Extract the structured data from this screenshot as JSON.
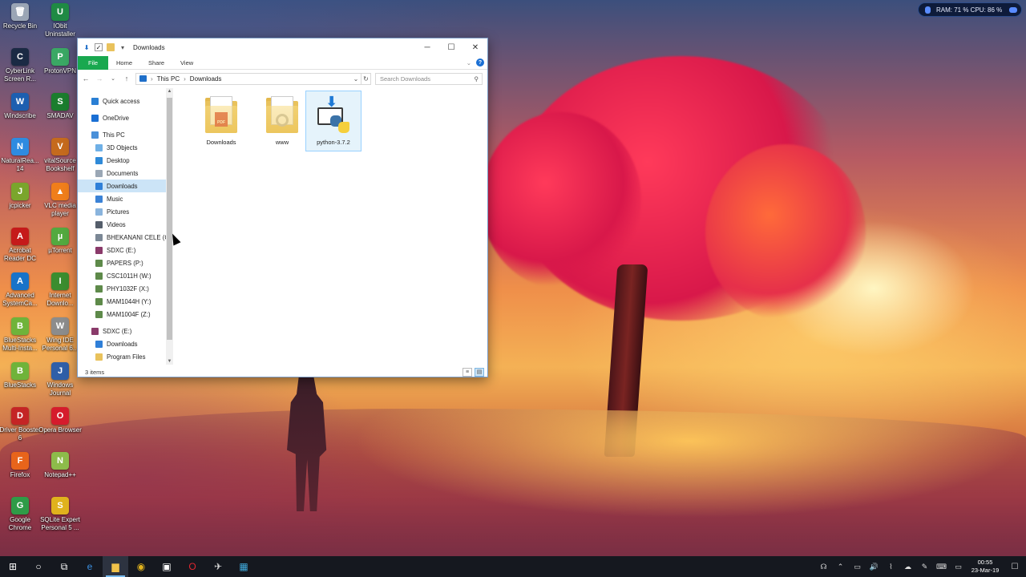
{
  "desktop": {
    "icons": [
      {
        "label": "Recycle Bin",
        "color": "#9aa5b5",
        "glyph": "🗑"
      },
      {
        "label": "IObit Uninstaller",
        "color": "#1f8a44",
        "glyph": "U"
      },
      {
        "label": "CyberLink Screen R...",
        "color": "#1b2a44",
        "glyph": "C"
      },
      {
        "label": "ProtonVPN",
        "color": "#3aa864",
        "glyph": "P"
      },
      {
        "label": "Windscribe",
        "color": "#1d5fb0",
        "glyph": "W"
      },
      {
        "label": "SMADAV",
        "color": "#1b7d2e",
        "glyph": "S"
      },
      {
        "label": "NaturalRea... 14",
        "color": "#2f8be0",
        "glyph": "N"
      },
      {
        "label": "vitalSource Bookshelf",
        "color": "#c56a1d",
        "glyph": "V"
      },
      {
        "label": "jcpicker",
        "color": "#7aa52c",
        "glyph": "J"
      },
      {
        "label": "VLC media player",
        "color": "#f07e1b",
        "glyph": "▲"
      },
      {
        "label": "Acrobat Reader DC",
        "color": "#c51a1a",
        "glyph": "A"
      },
      {
        "label": "µTorrent",
        "color": "#53a93f",
        "glyph": "µ"
      },
      {
        "label": "Advanced SystemCa...",
        "color": "#1873c9",
        "glyph": "A"
      },
      {
        "label": "Internet Downlo...",
        "color": "#3b8d2f",
        "glyph": "I"
      },
      {
        "label": "BlueStacks Multi-Insta...",
        "color": "#6fb33a",
        "glyph": "B"
      },
      {
        "label": "Wing IDE Personal 6...",
        "color": "#8c8c8c",
        "glyph": "W"
      },
      {
        "label": "BlueStacks",
        "color": "#6fb33a",
        "glyph": "B"
      },
      {
        "label": "Windows Journal",
        "color": "#2f5fa8",
        "glyph": "J"
      },
      {
        "label": "Driver Booster 6",
        "color": "#c42525",
        "glyph": "D"
      },
      {
        "label": "Opera Browser",
        "color": "#d51c2c",
        "glyph": "O"
      },
      {
        "label": "Firefox",
        "color": "#e8641b",
        "glyph": "F"
      },
      {
        "label": "Notepad++",
        "color": "#8dbb4a",
        "glyph": "N"
      },
      {
        "label": "Google Chrome",
        "color": "#2f9b47",
        "glyph": "G"
      },
      {
        "label": "SQLite Expert Personal 5 ...",
        "color": "#e0b21d",
        "glyph": "S"
      }
    ]
  },
  "widget": {
    "text": "RAM: 71 %  CPU: 86 %"
  },
  "window": {
    "title": "Downloads",
    "controls": {
      "minimize": "─",
      "maximize": "☐",
      "close": "✕"
    },
    "ribbon": {
      "file": "File",
      "tabs": [
        "Home",
        "Share",
        "View"
      ],
      "help": "?"
    },
    "address": {
      "root": "This PC",
      "current": "Downloads",
      "separator": "›"
    },
    "search_placeholder": "Search Downloads",
    "nav": [
      {
        "label": "Quick access",
        "icon": "star-icon",
        "color": "#2a7fd4",
        "indent": 1
      },
      {
        "label": "OneDrive",
        "icon": "cloud-icon",
        "color": "#1a6fd4",
        "indent": 1
      },
      {
        "label": "This PC",
        "icon": "computer-icon",
        "color": "#4a90d9",
        "indent": 1
      },
      {
        "label": "3D Objects",
        "icon": "cube-icon",
        "color": "#6fb0e6",
        "indent": 2
      },
      {
        "label": "Desktop",
        "icon": "desktop-icon",
        "color": "#2f8ad8",
        "indent": 2
      },
      {
        "label": "Documents",
        "icon": "document-icon",
        "color": "#9aa7b5",
        "indent": 2
      },
      {
        "label": "Downloads",
        "icon": "download-icon",
        "color": "#2f7fd8",
        "indent": 2,
        "selected": true
      },
      {
        "label": "Music",
        "icon": "music-icon",
        "color": "#3b82d6",
        "indent": 2
      },
      {
        "label": "Pictures",
        "icon": "picture-icon",
        "color": "#8ab4dd",
        "indent": 2
      },
      {
        "label": "Videos",
        "icon": "video-icon",
        "color": "#555e6b",
        "indent": 2
      },
      {
        "label": "BHEKANANI CELE (C:",
        "icon": "drive-icon",
        "color": "#7b8795",
        "indent": 2
      },
      {
        "label": "SDXC (E:)",
        "icon": "sd-card-icon",
        "color": "#8a3a6a",
        "indent": 2
      },
      {
        "label": "PAPERS (P:)",
        "icon": "network-drive-icon",
        "color": "#5e8a4a",
        "indent": 2
      },
      {
        "label": "CSC1011H (W:)",
        "icon": "network-drive-icon",
        "color": "#5e8a4a",
        "indent": 2
      },
      {
        "label": "PHY1032F (X:)",
        "icon": "network-drive-icon",
        "color": "#5e8a4a",
        "indent": 2
      },
      {
        "label": "MAM1044H (Y:)",
        "icon": "network-drive-icon",
        "color": "#5e8a4a",
        "indent": 2
      },
      {
        "label": "MAM1004F (Z:)",
        "icon": "network-drive-icon",
        "color": "#5e8a4a",
        "indent": 2
      },
      {
        "label": "SDXC (E:)",
        "icon": "sd-card-icon",
        "color": "#8a3a6a",
        "indent": 1
      },
      {
        "label": "Downloads",
        "icon": "download-icon",
        "color": "#2f7fd8",
        "indent": 2
      },
      {
        "label": "Program Files",
        "icon": "folder-icon",
        "color": "#e9c25c",
        "indent": 2
      }
    ],
    "files": [
      {
        "label": "Downloads",
        "kind": "pdf-folder"
      },
      {
        "label": "www",
        "kind": "gear-folder"
      },
      {
        "label": "python-3.7.2",
        "kind": "python-installer",
        "selected": true
      }
    ],
    "status": "3 items"
  },
  "taskbar": {
    "buttons": [
      {
        "name": "start-icon",
        "glyph": "⊞",
        "color": "#ffffff"
      },
      {
        "name": "cortana-icon",
        "glyph": "○",
        "color": "#ffffff"
      },
      {
        "name": "task-view-icon",
        "glyph": "⧉",
        "color": "#ffffff"
      },
      {
        "name": "edge-icon",
        "glyph": "e",
        "color": "#3b8fe0"
      },
      {
        "name": "file-explorer-icon",
        "glyph": "▆",
        "color": "#f0c24a",
        "active": true
      },
      {
        "name": "chrome-icon",
        "glyph": "◉",
        "color": "#e0b21d"
      },
      {
        "name": "store-icon",
        "glyph": "▣",
        "color": "#ffffff"
      },
      {
        "name": "opera-icon",
        "glyph": "O",
        "color": "#e0262f"
      },
      {
        "name": "wing-ide-icon",
        "glyph": "✈",
        "color": "#d8d8d8"
      },
      {
        "name": "screen-recorder-icon",
        "glyph": "▦",
        "color": "#3fa7d8"
      }
    ],
    "tray": [
      "☊",
      "⌃",
      "▭",
      "🔊",
      "⌇",
      "☁",
      "✎",
      "⌨",
      "▭"
    ],
    "time": "00:55",
    "date": "23-Mar-19",
    "notification": "☐"
  }
}
